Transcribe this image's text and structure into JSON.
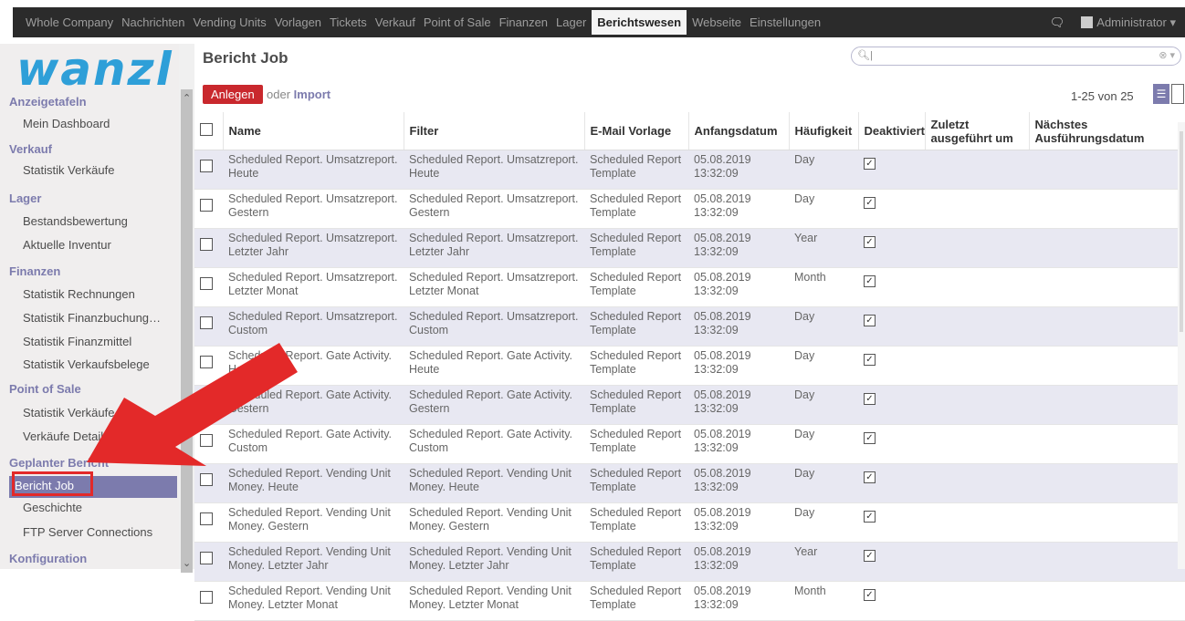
{
  "topnav": {
    "items": [
      "Whole Company",
      "Nachrichten",
      "Vending Units",
      "Vorlagen",
      "Tickets",
      "Verkauf",
      "Point of Sale",
      "Finanzen",
      "Lager",
      "Berichtswesen",
      "Webseite",
      "Einstellungen"
    ],
    "active_index": 9,
    "user": "Administrator"
  },
  "logo": "wanzl",
  "sidebar": {
    "sections": [
      {
        "label": "Anzeigetafeln",
        "items": [
          "Mein Dashboard"
        ]
      },
      {
        "label": "Verkauf",
        "items": [
          "Statistik Verkäufe"
        ]
      },
      {
        "label": "Lager",
        "items": [
          "Bestandsbewertung",
          "Aktuelle Inventur"
        ]
      },
      {
        "label": "Finanzen",
        "items": [
          "Statistik Rechnungen",
          "Statistik Finanzbuchung…",
          "Statistik Finanzmittel",
          "Statistik Verkaufsbelege"
        ]
      },
      {
        "label": "Point of Sale",
        "items": [
          "Statistik Verkäufe",
          "Verkäufe Details"
        ]
      },
      {
        "label": "Geplanter Bericht",
        "items": [
          "Bericht Job",
          "Geschichte",
          "FTP Server Connections"
        ]
      },
      {
        "label": "Konfiguration",
        "items": []
      }
    ],
    "active_item": "Bericht Job"
  },
  "main": {
    "title": "Bericht Job",
    "search_placeholder": "",
    "new_label": "Anlegen",
    "or_label": "oder",
    "import_label": "Import",
    "pager": "1-25 von 25"
  },
  "table": {
    "columns": [
      "Name",
      "Filter",
      "E-Mail Vorlage",
      "Anfangsdatum",
      "Häufigkeit",
      "Deaktiviert",
      "Zuletzt ausgeführt um",
      "Nächstes Ausführungsdatum"
    ],
    "rows": [
      {
        "name": [
          "Scheduled Report. Umsatzreport.",
          "Heute"
        ],
        "filter": [
          "Scheduled Report. Umsatzreport.",
          "Heute"
        ],
        "template": [
          "Scheduled Report",
          "Template"
        ],
        "date": [
          "05.08.2019",
          "13:32:09"
        ],
        "freq": "Day"
      },
      {
        "name": [
          "Scheduled Report. Umsatzreport.",
          "Gestern"
        ],
        "filter": [
          "Scheduled Report. Umsatzreport.",
          "Gestern"
        ],
        "template": [
          "Scheduled Report",
          "Template"
        ],
        "date": [
          "05.08.2019",
          "13:32:09"
        ],
        "freq": "Day"
      },
      {
        "name": [
          "Scheduled Report. Umsatzreport.",
          "Letzter Jahr"
        ],
        "filter": [
          "Scheduled Report. Umsatzreport.",
          "Letzter Jahr"
        ],
        "template": [
          "Scheduled Report",
          "Template"
        ],
        "date": [
          "05.08.2019",
          "13:32:09"
        ],
        "freq": "Year"
      },
      {
        "name": [
          "Scheduled Report. Umsatzreport.",
          "Letzter Monat"
        ],
        "filter": [
          "Scheduled Report. Umsatzreport.",
          "Letzter Monat"
        ],
        "template": [
          "Scheduled Report",
          "Template"
        ],
        "date": [
          "05.08.2019",
          "13:32:09"
        ],
        "freq": "Month"
      },
      {
        "name": [
          "Scheduled Report. Umsatzreport.",
          "Custom"
        ],
        "filter": [
          "Scheduled Report. Umsatzreport.",
          "Custom"
        ],
        "template": [
          "Scheduled Report",
          "Template"
        ],
        "date": [
          "05.08.2019",
          "13:32:09"
        ],
        "freq": "Day"
      },
      {
        "name": [
          "Scheduled Report. Gate Activity.",
          "Heute"
        ],
        "filter": [
          "Scheduled Report. Gate Activity.",
          "Heute"
        ],
        "template": [
          "Scheduled Report",
          "Template"
        ],
        "date": [
          "05.08.2019",
          "13:32:09"
        ],
        "freq": "Day"
      },
      {
        "name": [
          "Scheduled Report. Gate Activity.",
          "Gestern"
        ],
        "filter": [
          "Scheduled Report. Gate Activity.",
          "Gestern"
        ],
        "template": [
          "Scheduled Report",
          "Template"
        ],
        "date": [
          "05.08.2019",
          "13:32:09"
        ],
        "freq": "Day"
      },
      {
        "name": [
          "Scheduled Report. Gate Activity.",
          "Custom"
        ],
        "filter": [
          "Scheduled Report. Gate Activity.",
          "Custom"
        ],
        "template": [
          "Scheduled Report",
          "Template"
        ],
        "date": [
          "05.08.2019",
          "13:32:09"
        ],
        "freq": "Day"
      },
      {
        "name": [
          "Scheduled Report. Vending Unit",
          "Money. Heute"
        ],
        "filter": [
          "Scheduled Report. Vending Unit",
          "Money. Heute"
        ],
        "template": [
          "Scheduled Report",
          "Template"
        ],
        "date": [
          "05.08.2019",
          "13:32:09"
        ],
        "freq": "Day"
      },
      {
        "name": [
          "Scheduled Report. Vending Unit",
          "Money. Gestern"
        ],
        "filter": [
          "Scheduled Report. Vending Unit",
          "Money. Gestern"
        ],
        "template": [
          "Scheduled Report",
          "Template"
        ],
        "date": [
          "05.08.2019",
          "13:32:09"
        ],
        "freq": "Day"
      },
      {
        "name": [
          "Scheduled Report. Vending Unit",
          "Money. Letzter Jahr"
        ],
        "filter": [
          "Scheduled Report. Vending Unit",
          "Money. Letzter Jahr"
        ],
        "template": [
          "Scheduled Report",
          "Template"
        ],
        "date": [
          "05.08.2019",
          "13:32:09"
        ],
        "freq": "Year"
      },
      {
        "name": [
          "Scheduled Report. Vending Unit",
          "Money. Letzter Monat"
        ],
        "filter": [
          "Scheduled Report. Vending Unit",
          "Money. Letzter Monat"
        ],
        "template": [
          "Scheduled Report",
          "Template"
        ],
        "date": [
          "05.08.2019",
          "13:32:09"
        ],
        "freq": "Month"
      }
    ]
  },
  "colors": {
    "accent": "#7c7bad",
    "new_button": "#c9282d",
    "annotation": "#e32929",
    "topbar": "#2b2b2b",
    "row_odd": "#e8e8f2",
    "logo": "#2e9fd8"
  }
}
